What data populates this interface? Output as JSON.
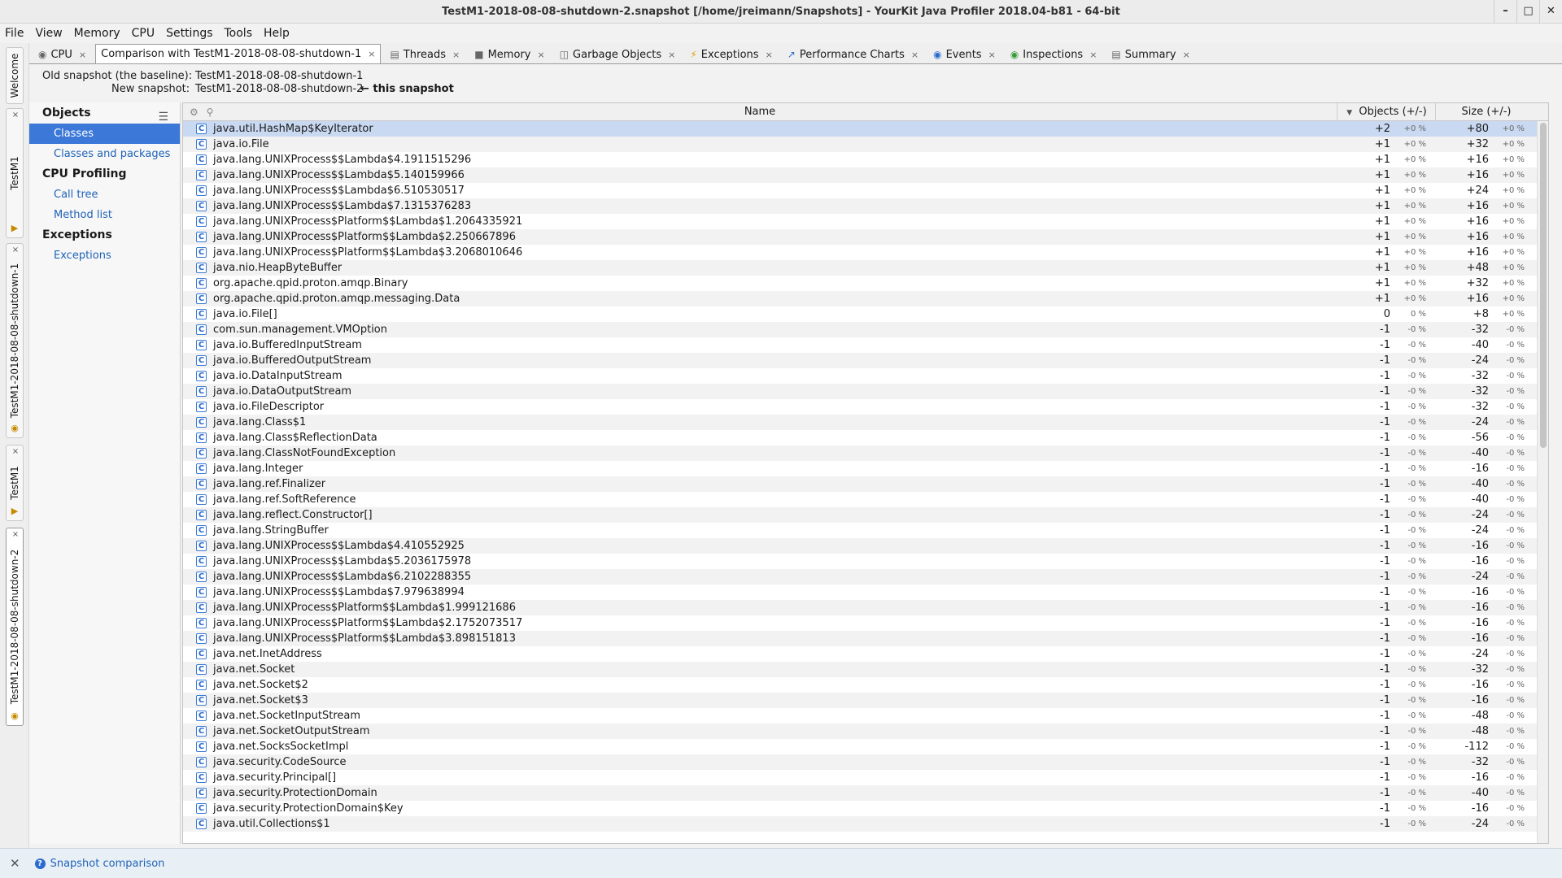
{
  "window": {
    "title": "TestM1-2018-08-08-shutdown-2.snapshot [/home/jreimann/Snapshots] - YourKit Java Profiler 2018.04-b81 - 64-bit"
  },
  "menu": [
    "File",
    "View",
    "Memory",
    "CPU",
    "Settings",
    "Tools",
    "Help"
  ],
  "side_tabs": [
    "Welcome",
    "TestM1",
    "TestM1-2018-08-08-shutdown-1",
    "TestM1",
    "TestM1-2018-08-08-shutdown-2"
  ],
  "tabs": [
    {
      "label": "CPU",
      "icon": "cpu-icon"
    },
    {
      "label": "Comparison with TestM1-2018-08-08-shutdown-1",
      "icon": ""
    },
    {
      "label": "Threads",
      "icon": "threads-icon"
    },
    {
      "label": "Memory",
      "icon": "memory-icon"
    },
    {
      "label": "Garbage Objects",
      "icon": "trash-icon"
    },
    {
      "label": "Exceptions",
      "icon": "lightning-icon"
    },
    {
      "label": "Performance Charts",
      "icon": "chart-icon"
    },
    {
      "label": "Events",
      "icon": "eye-icon"
    },
    {
      "label": "Inspections",
      "icon": "eye-icon"
    },
    {
      "label": "Summary",
      "icon": "document-icon"
    }
  ],
  "snapshot": {
    "old_label": "Old snapshot (the baseline):",
    "old_value": "TestM1-2018-08-08-shutdown-1",
    "new_label": "New snapshot:",
    "new_value": "TestM1-2018-08-08-shutdown-2",
    "new_marker": "← this snapshot"
  },
  "nav": {
    "objects": "Objects",
    "classes": "Classes",
    "classes_packages": "Classes and packages",
    "cpu_profiling": "CPU Profiling",
    "call_tree": "Call tree",
    "method_list": "Method list",
    "exceptions_header": "Exceptions",
    "exceptions": "Exceptions"
  },
  "table": {
    "headers": {
      "name": "Name",
      "objects": "Objects (+/-)",
      "size": "Size (+/-)"
    },
    "rows": [
      [
        "java.util.HashMap$KeyIterator",
        "+2",
        "+0 %",
        "+80",
        "+0 %"
      ],
      [
        "java.io.File",
        "+1",
        "+0 %",
        "+32",
        "+0 %"
      ],
      [
        "java.lang.UNIXProcess$$Lambda$4.1911515296",
        "+1",
        "+0 %",
        "+16",
        "+0 %"
      ],
      [
        "java.lang.UNIXProcess$$Lambda$5.140159966",
        "+1",
        "+0 %",
        "+16",
        "+0 %"
      ],
      [
        "java.lang.UNIXProcess$$Lambda$6.510530517",
        "+1",
        "+0 %",
        "+24",
        "+0 %"
      ],
      [
        "java.lang.UNIXProcess$$Lambda$7.1315376283",
        "+1",
        "+0 %",
        "+16",
        "+0 %"
      ],
      [
        "java.lang.UNIXProcess$Platform$$Lambda$1.2064335921",
        "+1",
        "+0 %",
        "+16",
        "+0 %"
      ],
      [
        "java.lang.UNIXProcess$Platform$$Lambda$2.250667896",
        "+1",
        "+0 %",
        "+16",
        "+0 %"
      ],
      [
        "java.lang.UNIXProcess$Platform$$Lambda$3.2068010646",
        "+1",
        "+0 %",
        "+16",
        "+0 %"
      ],
      [
        "java.nio.HeapByteBuffer",
        "+1",
        "+0 %",
        "+48",
        "+0 %"
      ],
      [
        "org.apache.qpid.proton.amqp.Binary",
        "+1",
        "+0 %",
        "+32",
        "+0 %"
      ],
      [
        "org.apache.qpid.proton.amqp.messaging.Data",
        "+1",
        "+0 %",
        "+16",
        "+0 %"
      ],
      [
        "java.io.File[]",
        "0",
        "0 %",
        "+8",
        "+0 %"
      ],
      [
        "com.sun.management.VMOption",
        "-1",
        "-0 %",
        "-32",
        "-0 %"
      ],
      [
        "java.io.BufferedInputStream",
        "-1",
        "-0 %",
        "-40",
        "-0 %"
      ],
      [
        "java.io.BufferedOutputStream",
        "-1",
        "-0 %",
        "-24",
        "-0 %"
      ],
      [
        "java.io.DataInputStream",
        "-1",
        "-0 %",
        "-32",
        "-0 %"
      ],
      [
        "java.io.DataOutputStream",
        "-1",
        "-0 %",
        "-32",
        "-0 %"
      ],
      [
        "java.io.FileDescriptor",
        "-1",
        "-0 %",
        "-32",
        "-0 %"
      ],
      [
        "java.lang.Class$1",
        "-1",
        "-0 %",
        "-24",
        "-0 %"
      ],
      [
        "java.lang.Class$ReflectionData",
        "-1",
        "-0 %",
        "-56",
        "-0 %"
      ],
      [
        "java.lang.ClassNotFoundException",
        "-1",
        "-0 %",
        "-40",
        "-0 %"
      ],
      [
        "java.lang.Integer",
        "-1",
        "-0 %",
        "-16",
        "-0 %"
      ],
      [
        "java.lang.ref.Finalizer",
        "-1",
        "-0 %",
        "-40",
        "-0 %"
      ],
      [
        "java.lang.ref.SoftReference",
        "-1",
        "-0 %",
        "-40",
        "-0 %"
      ],
      [
        "java.lang.reflect.Constructor[]",
        "-1",
        "-0 %",
        "-24",
        "-0 %"
      ],
      [
        "java.lang.StringBuffer",
        "-1",
        "-0 %",
        "-24",
        "-0 %"
      ],
      [
        "java.lang.UNIXProcess$$Lambda$4.410552925",
        "-1",
        "-0 %",
        "-16",
        "-0 %"
      ],
      [
        "java.lang.UNIXProcess$$Lambda$5.2036175978",
        "-1",
        "-0 %",
        "-16",
        "-0 %"
      ],
      [
        "java.lang.UNIXProcess$$Lambda$6.2102288355",
        "-1",
        "-0 %",
        "-24",
        "-0 %"
      ],
      [
        "java.lang.UNIXProcess$$Lambda$7.979638994",
        "-1",
        "-0 %",
        "-16",
        "-0 %"
      ],
      [
        "java.lang.UNIXProcess$Platform$$Lambda$1.999121686",
        "-1",
        "-0 %",
        "-16",
        "-0 %"
      ],
      [
        "java.lang.UNIXProcess$Platform$$Lambda$2.1752073517",
        "-1",
        "-0 %",
        "-16",
        "-0 %"
      ],
      [
        "java.lang.UNIXProcess$Platform$$Lambda$3.898151813",
        "-1",
        "-0 %",
        "-16",
        "-0 %"
      ],
      [
        "java.net.InetAddress",
        "-1",
        "-0 %",
        "-24",
        "-0 %"
      ],
      [
        "java.net.Socket",
        "-1",
        "-0 %",
        "-32",
        "-0 %"
      ],
      [
        "java.net.Socket$2",
        "-1",
        "-0 %",
        "-16",
        "-0 %"
      ],
      [
        "java.net.Socket$3",
        "-1",
        "-0 %",
        "-16",
        "-0 %"
      ],
      [
        "java.net.SocketInputStream",
        "-1",
        "-0 %",
        "-48",
        "-0 %"
      ],
      [
        "java.net.SocketOutputStream",
        "-1",
        "-0 %",
        "-48",
        "-0 %"
      ],
      [
        "java.net.SocksSocketImpl",
        "-1",
        "-0 %",
        "-112",
        "-0 %"
      ],
      [
        "java.security.CodeSource",
        "-1",
        "-0 %",
        "-32",
        "-0 %"
      ],
      [
        "java.security.Principal[]",
        "-1",
        "-0 %",
        "-16",
        "-0 %"
      ],
      [
        "java.security.ProtectionDomain",
        "-1",
        "-0 %",
        "-40",
        "-0 %"
      ],
      [
        "java.security.ProtectionDomain$Key",
        "-1",
        "-0 %",
        "-16",
        "-0 %"
      ],
      [
        "java.util.Collections$1",
        "-1",
        "-0 %",
        "-24",
        "-0 %"
      ]
    ]
  },
  "status": {
    "link": "Snapshot comparison"
  },
  "colors": {
    "selection": "#3b78d8",
    "row_selected": "#c9d9f2",
    "link": "#1f63b8"
  }
}
